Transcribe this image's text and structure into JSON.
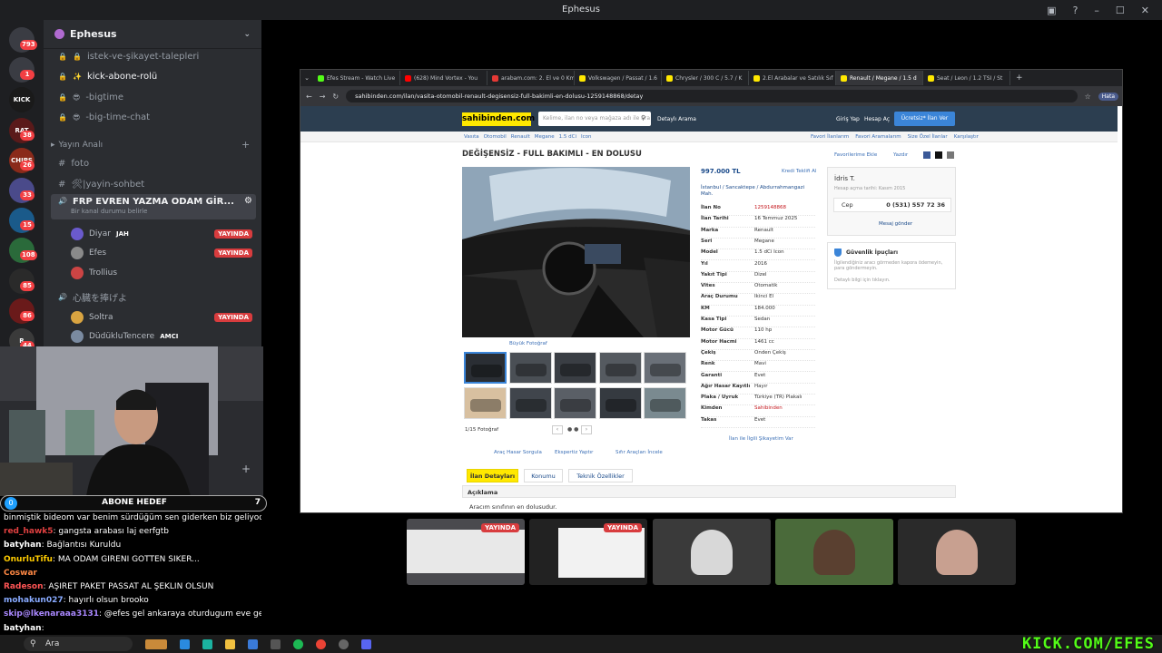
{
  "window": {
    "title": "Ephesus"
  },
  "servers": [
    {
      "label": "",
      "badge": "793",
      "color": "#3a3c43"
    },
    {
      "label": "",
      "badge": "1",
      "color": "#3a3c43"
    },
    {
      "label": "KICK",
      "badge": "",
      "color": "#1a1a1a"
    },
    {
      "label": "RAT",
      "badge": "38",
      "color": "#5a1a1a"
    },
    {
      "label": "CHIPS",
      "badge": "26",
      "color": "#8a2a1a"
    },
    {
      "label": "",
      "badge": "33",
      "color": "#4a4a8a"
    },
    {
      "label": "",
      "badge": "15",
      "color": "#1a5a8a"
    },
    {
      "label": "",
      "badge": "108",
      "color": "#2a6a3a"
    },
    {
      "label": "",
      "badge": "85",
      "color": "#2a2a2a"
    },
    {
      "label": "",
      "badge": "86",
      "color": "#6a1a1a"
    },
    {
      "label": "R",
      "badge": "44",
      "color": "#3a3a3a"
    }
  ],
  "guild": {
    "name": "Ephesus"
  },
  "channels": [
    {
      "icon": "🔒",
      "name": "istek-ve-şikayet-talepleri",
      "highlight": false
    },
    {
      "icon": "✨",
      "name": "kick-abone-rolü",
      "highlight": true
    },
    {
      "icon": "😎",
      "name": "-bigtime",
      "highlight": false
    },
    {
      "icon": "😎",
      "name": "-big-time-chat",
      "highlight": false
    }
  ],
  "category": {
    "name": "Yayın Analı"
  },
  "channels2": [
    {
      "icon": "#",
      "name": "foto"
    },
    {
      "icon": "#",
      "name": "🛠|yayin-sohbet"
    }
  ],
  "voice_channel": {
    "name": "FRP EVREN YAZMA ODAM GİR...",
    "status": "Bir kanal durumu belirle"
  },
  "voice_users": [
    {
      "name": "Diyar",
      "tag": "JAH",
      "live": "YAYINDA",
      "color": "#6a5acd"
    },
    {
      "name": "Efes",
      "tag": "",
      "live": "YAYINDA",
      "color": "#8a8a8a"
    },
    {
      "name": "Trollius",
      "tag": "",
      "live": "",
      "color": "#c44"
    }
  ],
  "voice_channel2": {
    "name": "心臓を捧げよ"
  },
  "voice_users2": [
    {
      "name": "Soltra",
      "tag": "",
      "live": "YAYINDA",
      "color": "#d9a441"
    },
    {
      "name": "DüdükluTencere",
      "tag": "AMCI",
      "live": "",
      "color": "#7a8aa0"
    }
  ],
  "abone": {
    "left": "0",
    "label": "ABONE HEDEF",
    "right": "7"
  },
  "chat": [
    {
      "user": "",
      "text": "binmiştik bideom var benim sürdüğüm sen giderken biz geliyoduk",
      "color": "#fff"
    },
    {
      "user": "red_hawk5",
      "text": ": gangsta arabası laj eerfgtb",
      "color": "#e04040"
    },
    {
      "user": "batyhan",
      "text": ": Bağlantısı Kuruldu",
      "color": "#fff"
    },
    {
      "user": "OnurluTifu",
      "text": ": MA ODAM GİRENİ GOTTEN SİKER...",
      "color": "#ffcc00"
    },
    {
      "user": "Coswar",
      "text": "",
      "color": "#ff8844"
    },
    {
      "user": "Radeson",
      "text": ": AŞIRET PAKET PASSAT AL ŞEKLİN OLSUN",
      "color": "#ff5555"
    },
    {
      "user": "mohakun027",
      "text": ": hayırlı olsun brooko",
      "color": "#88aaff"
    },
    {
      "user": "skip@lkenaraaa3131",
      "text": ": @efes gel ankaraya oturdugum eve gel",
      "color": "#aa88ff"
    },
    {
      "user": "batyhan",
      "text": ":",
      "color": "#fff"
    }
  ],
  "browser": {
    "tabs": [
      {
        "label": "Efes Stream - Watch Live",
        "color": "#53fc18"
      },
      {
        "label": "(628) Mind Vortex - You",
        "color": "#ff0000"
      },
      {
        "label": "arabam.com: 2. El ve 0 Km",
        "color": "#e53935"
      },
      {
        "label": "Volkswagen / Passat / 1.6",
        "color": "#ffe800"
      },
      {
        "label": "Chrysler / 300 C / 5.7 / K",
        "color": "#ffe800"
      },
      {
        "label": "2.El Arabalar ve Satılık Sıf",
        "color": "#ffe800"
      },
      {
        "label": "Renault / Megane / 1.5 d",
        "color": "#ffe800"
      },
      {
        "label": "Seat / Leon / 1.2 TSI / St",
        "color": "#ffe800"
      }
    ],
    "url": "sahibinden.com/ilan/vasita-otomobil-renault-degisensiz-full-bakimli-en-dolusu-1259148868/detay",
    "profile": "Hata"
  },
  "site": {
    "logo": "sahibinden.com",
    "search_placeholder": "Kelime, ilan no veya mağaza adı ile ara",
    "detailed_search": "Detaylı Arama",
    "login": "Giriş Yap",
    "register": "Hesap Aç",
    "post_ad": "Ücretsiz* İlan Ver",
    "breadcrumb": [
      "Vasıta",
      "Otomobil",
      "Renault",
      "Megane",
      "1.5 dCi",
      "Icon"
    ],
    "crumb_links": [
      "Favori İlanlarım",
      "Favori Aramalarım",
      "Size Özel İlanlar",
      "Karşılaştır"
    ],
    "title": "DEĞİŞENSİZ - FULL BAKIMLI - EN DOLUSU",
    "fav_add": "Favorilerime Ekle",
    "print": "Yazdır",
    "photo_label": "Büyük Fotoğraf",
    "photo_count": "1/15 Fotoğraf",
    "price": "997.000 TL",
    "credit": "Kredi Teklifi Al",
    "location": "İstanbul / Sancaktepe / Abdurrahmangazi Mah.",
    "details": [
      {
        "k": "İlan No",
        "v": "1259148868",
        "red": true
      },
      {
        "k": "İlan Tarihi",
        "v": "16 Temmuz 2025",
        "red": false
      },
      {
        "k": "Marka",
        "v": "Renault",
        "red": false
      },
      {
        "k": "Seri",
        "v": "Megane",
        "red": false
      },
      {
        "k": "Model",
        "v": "1.5 dCi Icon",
        "red": false
      },
      {
        "k": "Yıl",
        "v": "2016",
        "red": false
      },
      {
        "k": "Yakıt Tipi",
        "v": "Dizel",
        "red": false
      },
      {
        "k": "Vites",
        "v": "Otomatik",
        "red": false
      },
      {
        "k": "Araç Durumu",
        "v": "İkinci El",
        "red": false
      },
      {
        "k": "KM",
        "v": "184.000",
        "red": false
      },
      {
        "k": "Kasa Tipi",
        "v": "Sedan",
        "red": false
      },
      {
        "k": "Motor Gücü",
        "v": "110 hp",
        "red": false
      },
      {
        "k": "Motor Hacmi",
        "v": "1461 cc",
        "red": false
      },
      {
        "k": "Çekiş",
        "v": "Önden Çekiş",
        "red": false
      },
      {
        "k": "Renk",
        "v": "Mavi",
        "red": false
      },
      {
        "k": "Garanti",
        "v": "Evet",
        "red": false
      },
      {
        "k": "Ağır Hasar Kayıtlı",
        "v": "Hayır",
        "red": false
      },
      {
        "k": "Plaka / Uyruk",
        "v": "Türkiye (TR) Plakalı",
        "red": false
      },
      {
        "k": "Kimden",
        "v": "Sahibinden",
        "red": true
      },
      {
        "k": "Takas",
        "v": "Evet",
        "red": false
      }
    ],
    "report": "İlan ile İlgili Şikayetim Var",
    "seller_name": "İdris T.",
    "seller_since": "Hesap açma tarihi: Kasım 2015",
    "phone_label": "Cep",
    "phone": "0 (531) 557 72 36",
    "message": "Mesaj gönder",
    "safety_title": "Güvenlik İpuçları",
    "safety_text": "İlgilendiğiniz aracı görmeden kapora ödemeyin, para göndermeyin.",
    "safety_more": "Detaylı bilgi için tıklayın.",
    "actions": [
      "Araç Hasar Sorgula",
      "Ekspertiz Yaptır",
      "Sıfır Araçları İncele"
    ],
    "tabs": [
      "İlan Detayları",
      "Konumu",
      "Teknik Özellikler"
    ],
    "desc_head": "Açıklama",
    "desc": "Aracım sınıfının en dolusudur."
  },
  "tiles": [
    {
      "live": "YAYINDA"
    },
    {
      "live": "YAYINDA"
    },
    {
      "live": ""
    },
    {
      "live": ""
    },
    {
      "live": ""
    }
  ],
  "taskbar": {
    "search": "Ara"
  },
  "watermark": "KICK.COM/EFES"
}
